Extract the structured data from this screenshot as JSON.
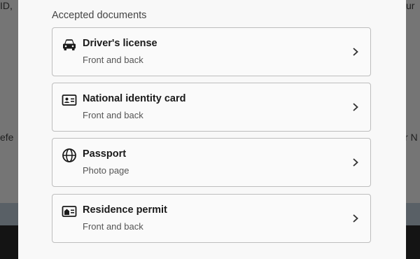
{
  "background": {
    "top_left_text": "ID,",
    "top_right_text": "ur",
    "mid_left_text": "efe",
    "mid_right_text": "r N"
  },
  "section": {
    "label": "Accepted documents"
  },
  "documents": [
    {
      "title": "Driver's license",
      "subtitle": "Front and back",
      "icon": "car-icon"
    },
    {
      "title": "National identity card",
      "subtitle": "Front and back",
      "icon": "id-card-icon"
    },
    {
      "title": "Passport",
      "subtitle": "Photo page",
      "icon": "globe-icon"
    },
    {
      "title": "Residence permit",
      "subtitle": "Front and back",
      "icon": "residence-card-icon"
    }
  ],
  "colors": {
    "modal_bg": "#f8f8f8",
    "card_border": "#bdbdbd",
    "text_primary": "#1a1a1a",
    "text_secondary": "#555555"
  }
}
